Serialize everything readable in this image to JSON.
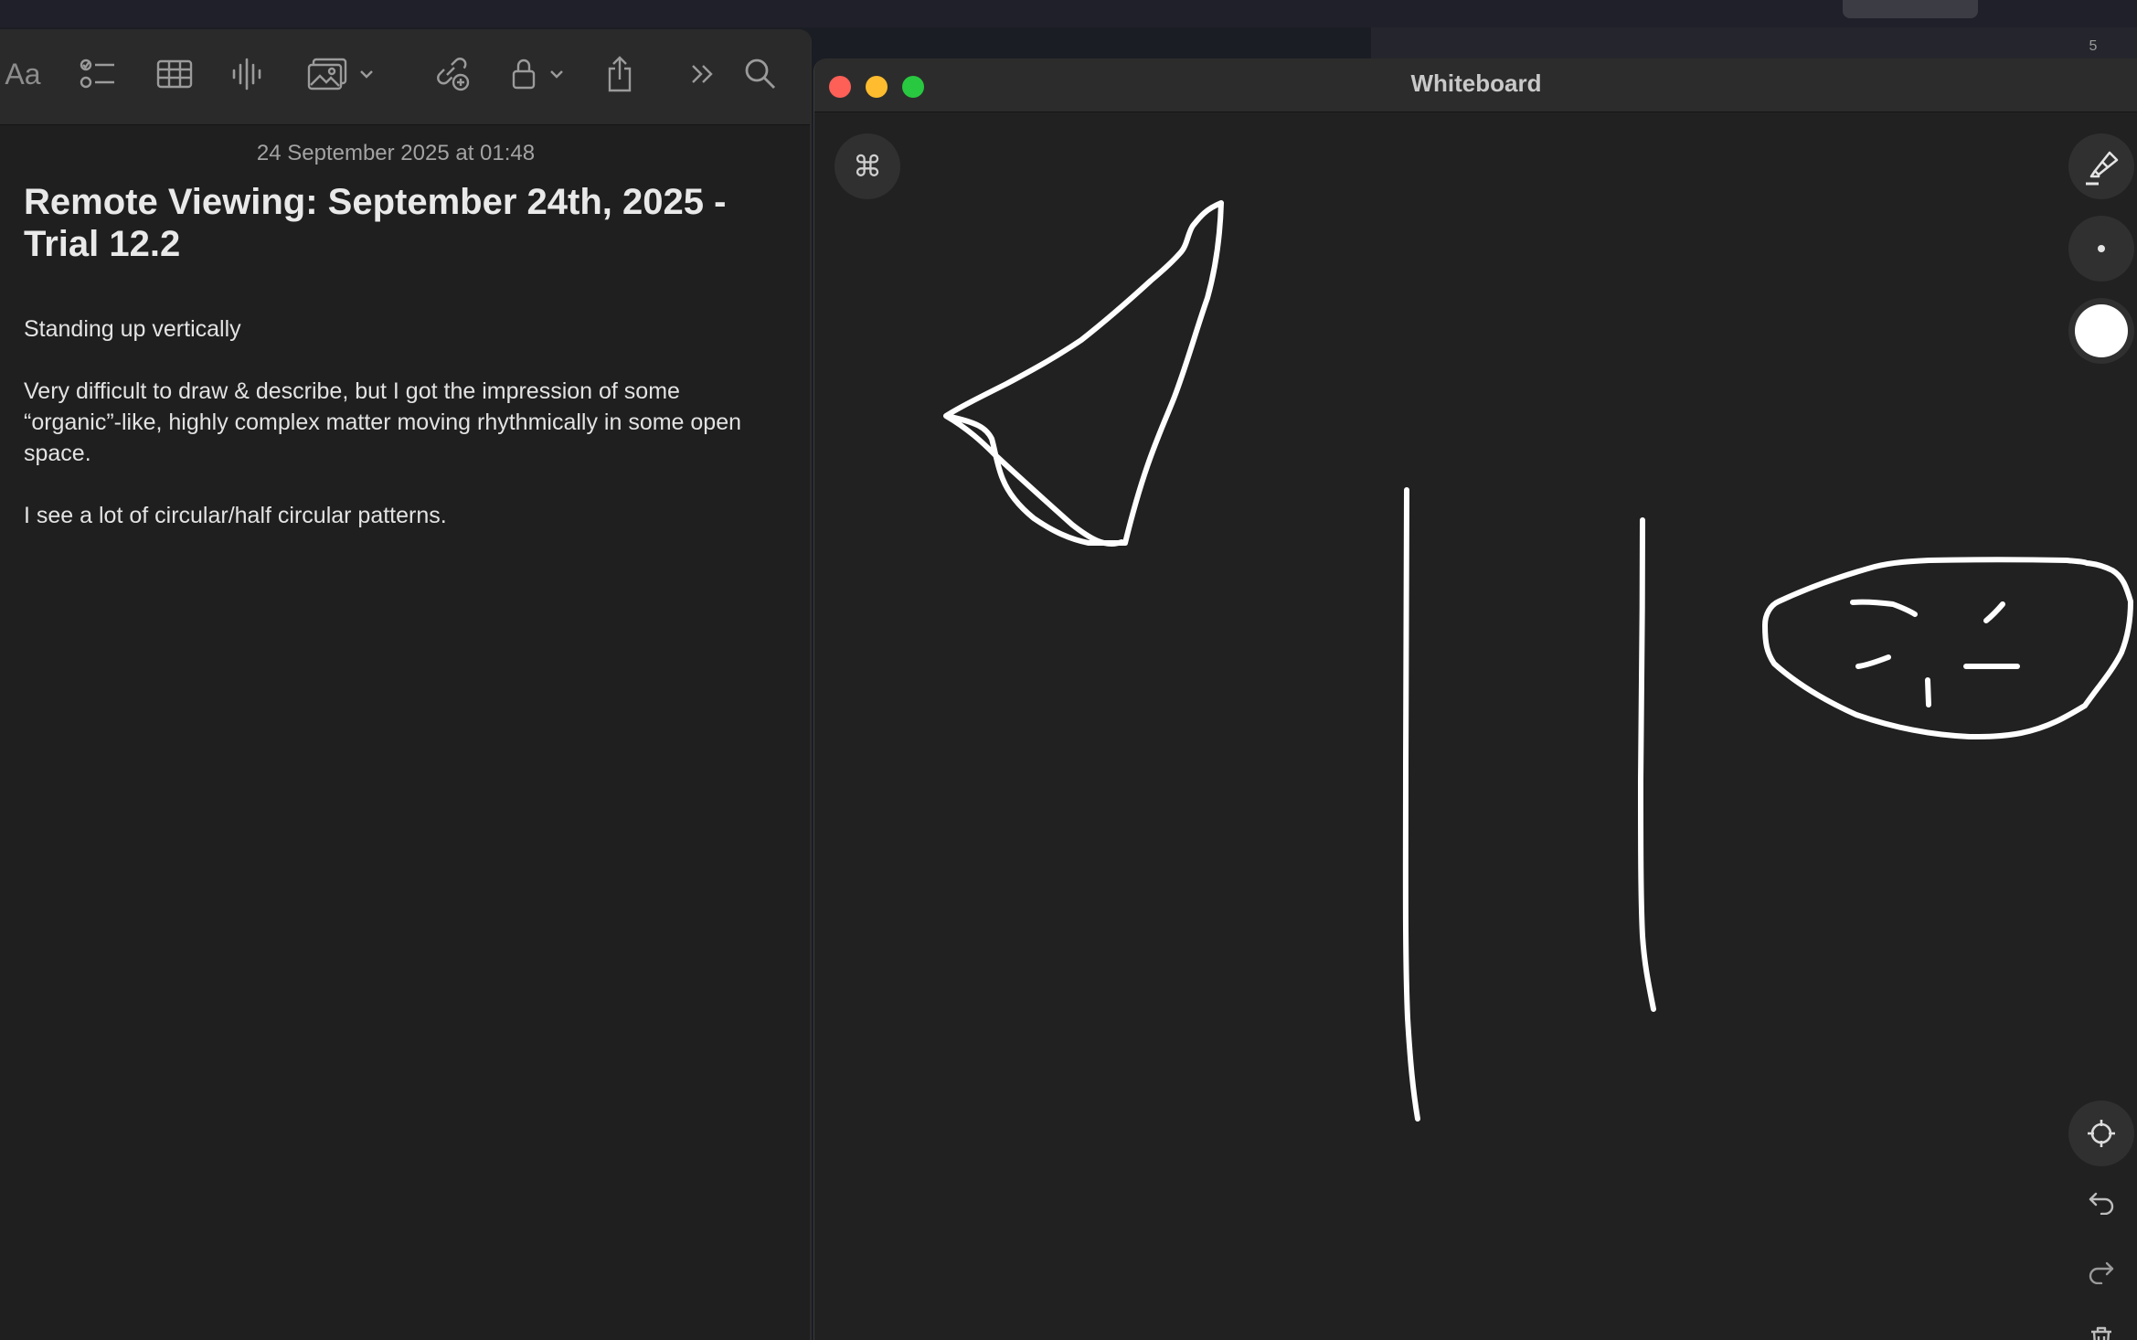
{
  "background_browser": {
    "badge_count": "5"
  },
  "notes": {
    "toolbar": {
      "format_label": "Aa",
      "icons": [
        "checklist-icon",
        "table-icon",
        "audio-icon",
        "media-icon",
        "chevron-down-icon",
        "link-icon",
        "lock-icon",
        "chevron-down-icon",
        "share-icon",
        "more-icon",
        "search-icon"
      ]
    },
    "date": "24 September 2025 at 01:48",
    "title": "Remote Viewing: September 24th, 2025 - Trial 12.2",
    "paragraphs": [
      "Standing up vertically",
      "Very difficult to draw & describe, but I got the impression of some “organic”-like, highly complex matter moving rhythmically in some open space.",
      "I see a lot of circular/half circular patterns."
    ]
  },
  "whiteboard": {
    "title": "Whiteboard",
    "command_key": "⌘",
    "traffic_lights": {
      "close": "#fe5f57",
      "minimize": "#febc2e",
      "zoom": "#28c840"
    },
    "stroke_color": "#ffffff",
    "tools": [
      "highlighter-icon",
      "brush-size-dot-icon",
      "color-white-swatch",
      "recenter-icon",
      "undo-icon",
      "redo-icon",
      "trash-icon"
    ]
  }
}
